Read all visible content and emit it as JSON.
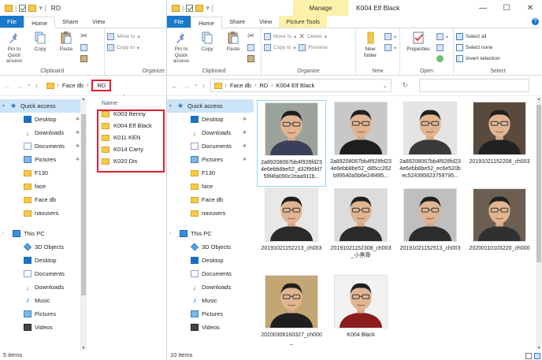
{
  "left_window": {
    "title": "RD",
    "tabs": [
      "File",
      "Home",
      "Share",
      "View"
    ],
    "ribbon": {
      "clipboard": {
        "pin_label": "Pin to Quick access",
        "copy_label": "Copy",
        "paste_label": "Paste",
        "group_label": "Clipboard"
      },
      "organize": {
        "move_to": "Move to",
        "copy_to": "Copy to",
        "group_label": "Organize"
      }
    },
    "address": {
      "crumbs": [
        "Face db",
        "RD"
      ]
    },
    "column_header": "Name",
    "files": [
      "K003 Benny",
      "K004 Elf Black",
      "K011 KEN",
      "K014 Carry",
      "K020 Dis"
    ],
    "status": "5 items"
  },
  "right_window": {
    "title": "K004 Elf Black",
    "manage_label": "Manage",
    "tabs": [
      "File",
      "Home",
      "Share",
      "View",
      "Picture Tools"
    ],
    "window_controls": [
      "—",
      "☐",
      "✕"
    ],
    "ribbon": {
      "clipboard": {
        "pin_label": "Pin to Quick access",
        "copy_label": "Copy",
        "paste_label": "Paste",
        "group_label": "Clipboard"
      },
      "organize": {
        "move_to": "Move to",
        "copy_to": "Copy to",
        "delete": "Delete",
        "rename": "Rename",
        "group_label": "Organize"
      },
      "new": {
        "new_folder": "New folder",
        "group_label": "New"
      },
      "open": {
        "properties": "Properties",
        "group_label": "Open"
      },
      "select": {
        "select_all": "Select all",
        "select_none": "Select none",
        "invert_selection": "Invert selection",
        "group_label": "Select"
      }
    },
    "address": {
      "crumbs": [
        "Face db",
        "RD",
        "K004 Elf Black"
      ]
    },
    "thumbnails": [
      {
        "name": "2a89208067bb4f928fd234e6ebb8be52_d32f96fd759f4fa090c2eaa911b...",
        "bg": "#9aa39a",
        "shirt": "#3a3f5a",
        "selected": true
      },
      {
        "name": "2a89208067bb4f928fd234e6ebb8be52_d85cc262b99540a5b6e24f495...",
        "bg": "#c8c8c8",
        "shirt": "#1e1e1e",
        "selected": false
      },
      {
        "name": "2a89208067bb4f928fd234e6ebb8be52_ec6e520bec524395823759795...",
        "bg": "#e4e4e4",
        "shirt": "#3a3a3a",
        "selected": false
      },
      {
        "name": "20191021152208_ch003",
        "bg": "#5a4a3e",
        "shirt": "#222222",
        "selected": false
      },
      {
        "name": "20191021152213_ch003",
        "bg": "#e8e8e8",
        "shirt": "#2a2a2a",
        "selected": false
      },
      {
        "name": "20191021152308_ch003_小黑哥",
        "bg": "#dcdcdc",
        "shirt": "#2a2a2a",
        "selected": false
      },
      {
        "name": "20191021152513_ch003",
        "bg": "#bfbfbf",
        "shirt": "#2d2d2d",
        "selected": false
      },
      {
        "name": "20200110103220_ch000",
        "bg": "#6d5e52",
        "shirt": "#303030",
        "selected": false
      },
      {
        "name": "20200306160327_ch000_",
        "bg": "#c4a574",
        "shirt": "#1f1f1f",
        "selected": false
      },
      {
        "name": "K004 Black",
        "bg": "#f2f2f2",
        "shirt": "#8b1c1c",
        "selected": false
      }
    ],
    "status": "10 items"
  },
  "nav_pane": {
    "quick_access": "Quick access",
    "items": [
      {
        "label": "Desktop",
        "icon": "desktop-icon",
        "pinned": true
      },
      {
        "label": "Downloads",
        "icon": "download-icon",
        "pinned": true
      },
      {
        "label": "Documents",
        "icon": "documents-icon",
        "pinned": true
      },
      {
        "label": "Pictures",
        "icon": "pictures-icon",
        "pinned": true
      },
      {
        "label": "F130",
        "icon": "folder-icon",
        "pinned": false
      },
      {
        "label": "face",
        "icon": "folder-icon",
        "pinned": false
      },
      {
        "label": "Face db",
        "icon": "folder-icon",
        "pinned": false
      },
      {
        "label": "navusers",
        "icon": "folder-icon",
        "pinned": false
      }
    ],
    "this_pc": "This PC",
    "pc_items": [
      {
        "label": "3D Objects",
        "icon": "3d-objects-icon"
      },
      {
        "label": "Desktop",
        "icon": "desktop-icon"
      },
      {
        "label": "Documents",
        "icon": "documents-icon"
      },
      {
        "label": "Downloads",
        "icon": "download-icon"
      },
      {
        "label": "Music",
        "icon": "music-icon"
      },
      {
        "label": "Pictures",
        "icon": "pictures-icon"
      },
      {
        "label": "Videos",
        "icon": "videos-icon"
      }
    ]
  },
  "colors": {
    "file_tab": "#1979ca",
    "selection": "#cce4f7",
    "highlight_red": "#e11d2e",
    "manage_tab": "#fbf1a9"
  }
}
